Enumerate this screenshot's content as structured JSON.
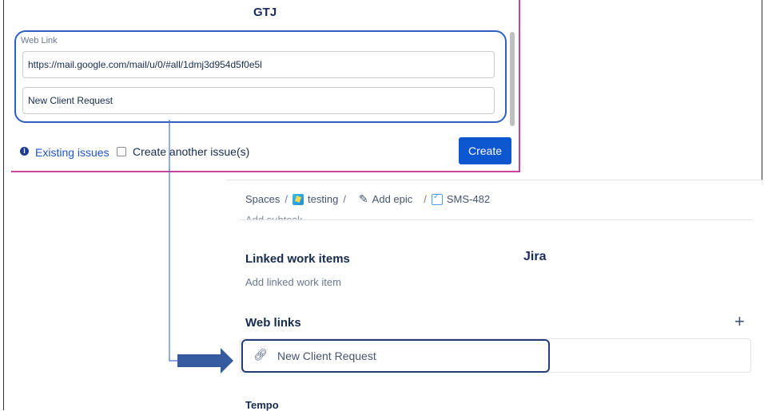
{
  "gtj": {
    "title": "GTJ",
    "web_link_label": "Web Link",
    "url_value": "https://mail.google.com/mail/u/0/#all/1dmj3d954d5f0e5l",
    "title_value": "New Client Request",
    "info_icon": "i",
    "existing_issues_label": "Existing issues",
    "create_another_label": "Create another issue(s)",
    "create_button_label": "Create",
    "accent_color": "#0c56d0",
    "border_color": "#c8429a"
  },
  "jira": {
    "title": "Jira",
    "breadcrumb": {
      "spaces": "Spaces",
      "project": "testing",
      "epic": "Add epic",
      "issue": "SMS-482"
    },
    "add_subtask_label": "Add subtask",
    "linked_items_heading": "Linked work items",
    "add_linked_item": "Add linked work item",
    "web_links_heading": "Web links",
    "add_web_link_icon": "+",
    "web_link_text": "New Client Request",
    "tempo_heading": "Tempo"
  }
}
